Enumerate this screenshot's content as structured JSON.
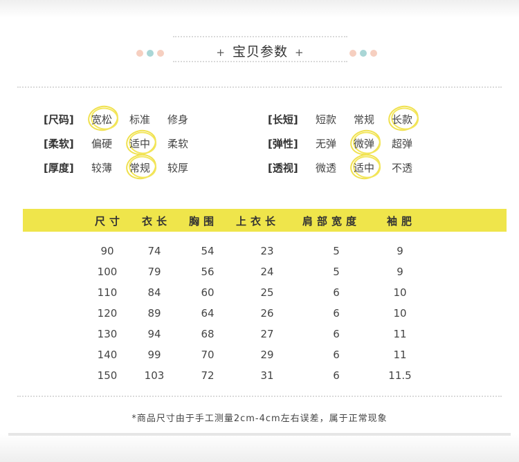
{
  "header": {
    "title": "宝贝参数",
    "plus": "+",
    "dot_colors": [
      "#f6cfc0",
      "#a9d6d6",
      "#f6cfc0"
    ]
  },
  "params": {
    "left": [
      {
        "label": "[尺码]",
        "options": [
          "宽松",
          "标准",
          "修身"
        ],
        "selected": 0
      },
      {
        "label": "[柔软]",
        "options": [
          "偏硬",
          "适中",
          "柔软"
        ],
        "selected": 1
      },
      {
        "label": "[厚度]",
        "options": [
          "较薄",
          "常规",
          "较厚"
        ],
        "selected": 1
      }
    ],
    "right": [
      {
        "label": "[长短]",
        "options": [
          "短款",
          "常规",
          "长款"
        ],
        "selected": 2
      },
      {
        "label": "[弹性]",
        "options": [
          "无弹",
          "微弹",
          "超弹"
        ],
        "selected": 1
      },
      {
        "label": "[透视]",
        "options": [
          "微透",
          "适中",
          "不透"
        ],
        "selected": 1
      }
    ]
  },
  "size_table": {
    "headers": [
      "尺寸",
      "衣长",
      "胸围",
      "上衣长",
      "肩部宽度",
      "袖肥"
    ],
    "rows": [
      [
        "90",
        "74",
        "54",
        "23",
        "5",
        "9"
      ],
      [
        "100",
        "79",
        "56",
        "24",
        "5",
        "9"
      ],
      [
        "110",
        "84",
        "60",
        "25",
        "6",
        "10"
      ],
      [
        "120",
        "89",
        "64",
        "26",
        "6",
        "10"
      ],
      [
        "130",
        "94",
        "68",
        "27",
        "6",
        "11"
      ],
      [
        "140",
        "99",
        "70",
        "29",
        "6",
        "11"
      ],
      [
        "150",
        "103",
        "72",
        "31",
        "6",
        "11.5"
      ]
    ],
    "header_color": "#efe54b"
  },
  "note": "*商品尺寸由于手工测量2cm-4cm左右误差，属于正常现象"
}
